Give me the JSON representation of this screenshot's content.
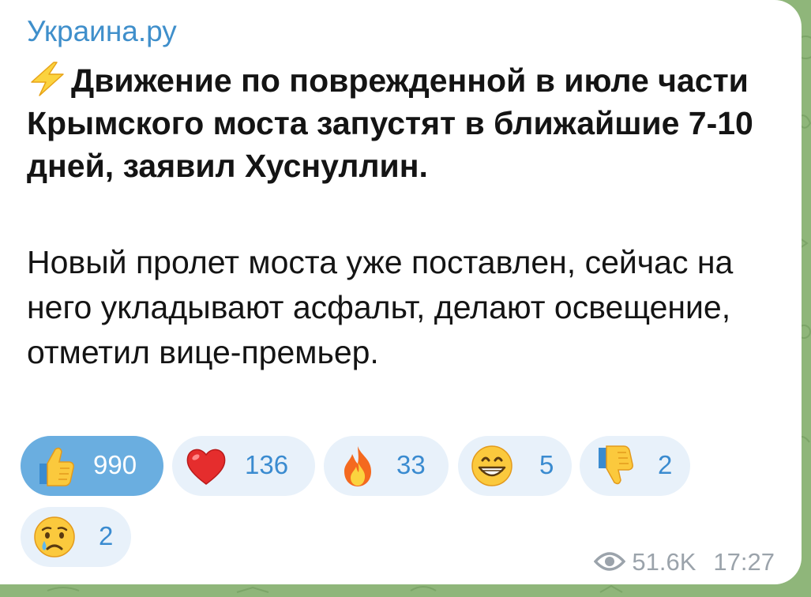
{
  "message": {
    "channel_name": "Украина.ру",
    "headline": "Движение по поврежденной в июле части Крымского моста запустят в ближайшие 7-10 дней, заявил Хуснуллин.",
    "headline_icon": "lightning-emoji",
    "body": "Новый пролет моста уже поставлен, сейчас на него укладывают асфальт, делают освещение, отметил вице-премьер.",
    "views": "51.6K",
    "time": "17:27"
  },
  "reactions": [
    {
      "icon": "thumbs-up-emoji",
      "count": "990",
      "active": true
    },
    {
      "icon": "red-heart-emoji",
      "count": "136",
      "active": false
    },
    {
      "icon": "fire-emoji",
      "count": "33",
      "active": false
    },
    {
      "icon": "grinning-face-emoji",
      "count": "5",
      "active": false
    },
    {
      "icon": "thumbs-down-emoji",
      "count": "2",
      "active": false
    },
    {
      "icon": "crying-face-emoji",
      "count": "2",
      "active": false
    }
  ],
  "colors": {
    "channel_name": "#3f8fcb",
    "reaction_active_bg": "#6aaee0",
    "reaction_bg": "#e8f1fa",
    "reaction_count": "#3a8bd0",
    "meta": "#9ba3ab",
    "wallpaper": "#8fb67a"
  }
}
